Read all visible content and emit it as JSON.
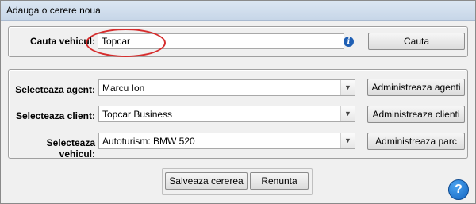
{
  "window": {
    "title": "Adauga o cerere noua"
  },
  "search": {
    "label": "Cauta vehicul:",
    "value": "Topcar",
    "button_label": "Cauta",
    "info_icon_glyph": "i"
  },
  "selection": {
    "agent": {
      "label": "Selecteaza agent:",
      "value": "Marcu Ion",
      "manage_label": "Administreaza agenti"
    },
    "client": {
      "label": "Selecteaza client:",
      "value": "Topcar Business",
      "manage_label": "Administreaza clienti"
    },
    "vehicle": {
      "label": "Selecteaza vehicul:",
      "value": "Autoturism: BMW 520",
      "manage_label": "Administreaza parc"
    }
  },
  "actions": {
    "save_label": "Salveaza cererea",
    "cancel_label": "Renunta"
  },
  "help": {
    "glyph": "?"
  },
  "colors": {
    "highlight": "#d62d2d",
    "info_icon": "#1f5fb4",
    "help_icon": "#1565c0"
  }
}
